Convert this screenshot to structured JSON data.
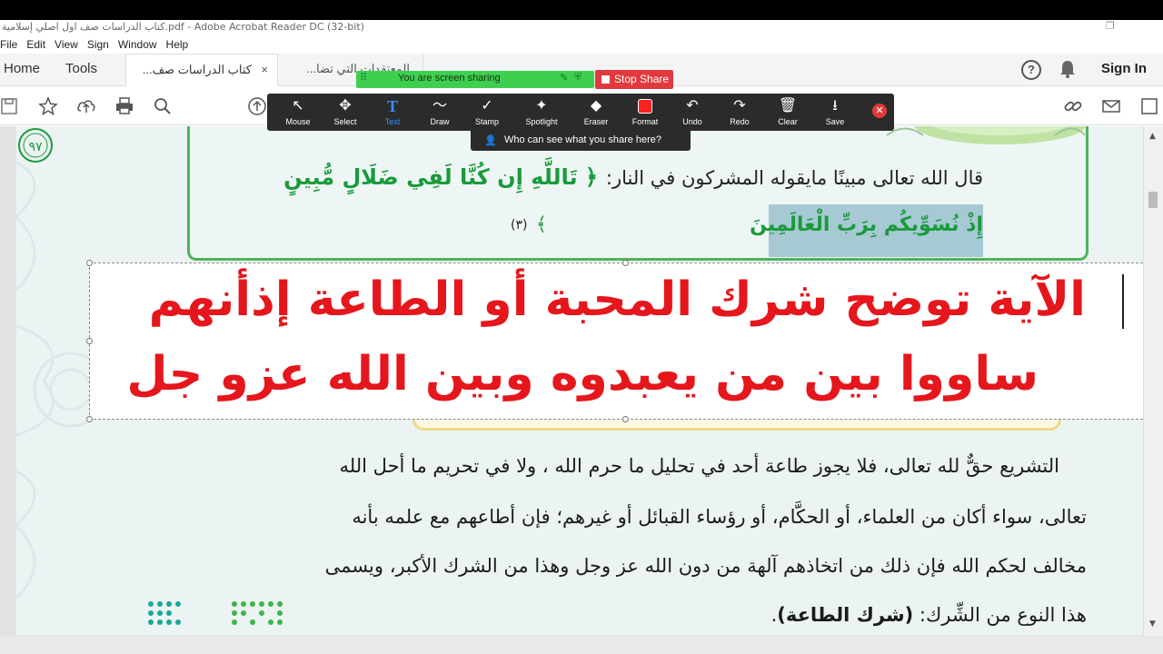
{
  "window": {
    "title": "كتاب الدراسات صف اول اصلي إسلامية.pdf - Adobe Acrobat Reader DC (32-bit)"
  },
  "menu": [
    "File",
    "Edit",
    "View",
    "Sign",
    "Window",
    "Help"
  ],
  "tabs": {
    "home": "Home",
    "tools": "Tools",
    "doc1": "كتاب الدراسات صف...",
    "doc2": "المعتقدات التي تضا...",
    "close": "×",
    "sign_in": "Sign In"
  },
  "share": {
    "banner": "You are screen sharing",
    "stop": "Stop Share",
    "who": "Who can see what you share here?"
  },
  "annotate_tools": [
    {
      "label": "Mouse",
      "icon": "↖"
    },
    {
      "label": "Select",
      "icon": "✥"
    },
    {
      "label": "Text",
      "icon": "T"
    },
    {
      "label": "Draw",
      "icon": "〜"
    },
    {
      "label": "Stamp",
      "icon": "✓"
    },
    {
      "label": "Spotlight",
      "icon": "✦"
    },
    {
      "label": "Eraser",
      "icon": "◆"
    },
    {
      "label": "Format",
      "icon": ""
    },
    {
      "label": "Undo",
      "icon": "↶"
    },
    {
      "label": "Redo",
      "icon": "↷"
    },
    {
      "label": "Clear",
      "icon": "🗑"
    },
    {
      "label": "Save",
      "icon": "⭳"
    }
  ],
  "document": {
    "intro": "قال الله تعالى مبينًا مايقوله المشركون في النار:",
    "verse1": "﴿ تَاللَّهِ إِن كُنَّا لَفِي ضَلَالٍ مُّبِينٍ",
    "verse_num": "٩٧",
    "verse2": "إِذْ نُسَوِّيكُم بِرَبِّ الْعَالَمِينَ",
    "verse2_end": "﴾",
    "footnote": "(٣)",
    "annotation_line1": "الآية توضح شرك المحبة أو الطاعة إذأنهم",
    "annotation_line2": "ساووا بين من يعبدوه وبين الله عزو جل",
    "para1": "التشريع حقٌّ لله تعالى، فلا يجوز طاعة أحد في تحليل ما حرم الله ، ولا في تحريم ما أحل الله",
    "para2": "تعالى، سواء أكان من العلماء، أو الحكَّام، أو رؤساء القبائل أو غيرهم؛ فإن أطاعهم مع علمه بأنه",
    "para3": "مخالف لحكم الله فإن ذلك من اتخاذهم آلهة من دون الله عز وجل وهذا من الشرك الأكبر، ويسمى",
    "para4_a": "هذا النوع من الشِّرك: ",
    "para4_b": "(شرك الطاعة)",
    "para4_c": "."
  },
  "colors": {
    "annotation_red": "#e5161c",
    "verse_green": "#1a9a3a",
    "share_green": "#3fcf4f",
    "stop_red": "#e0393e"
  }
}
